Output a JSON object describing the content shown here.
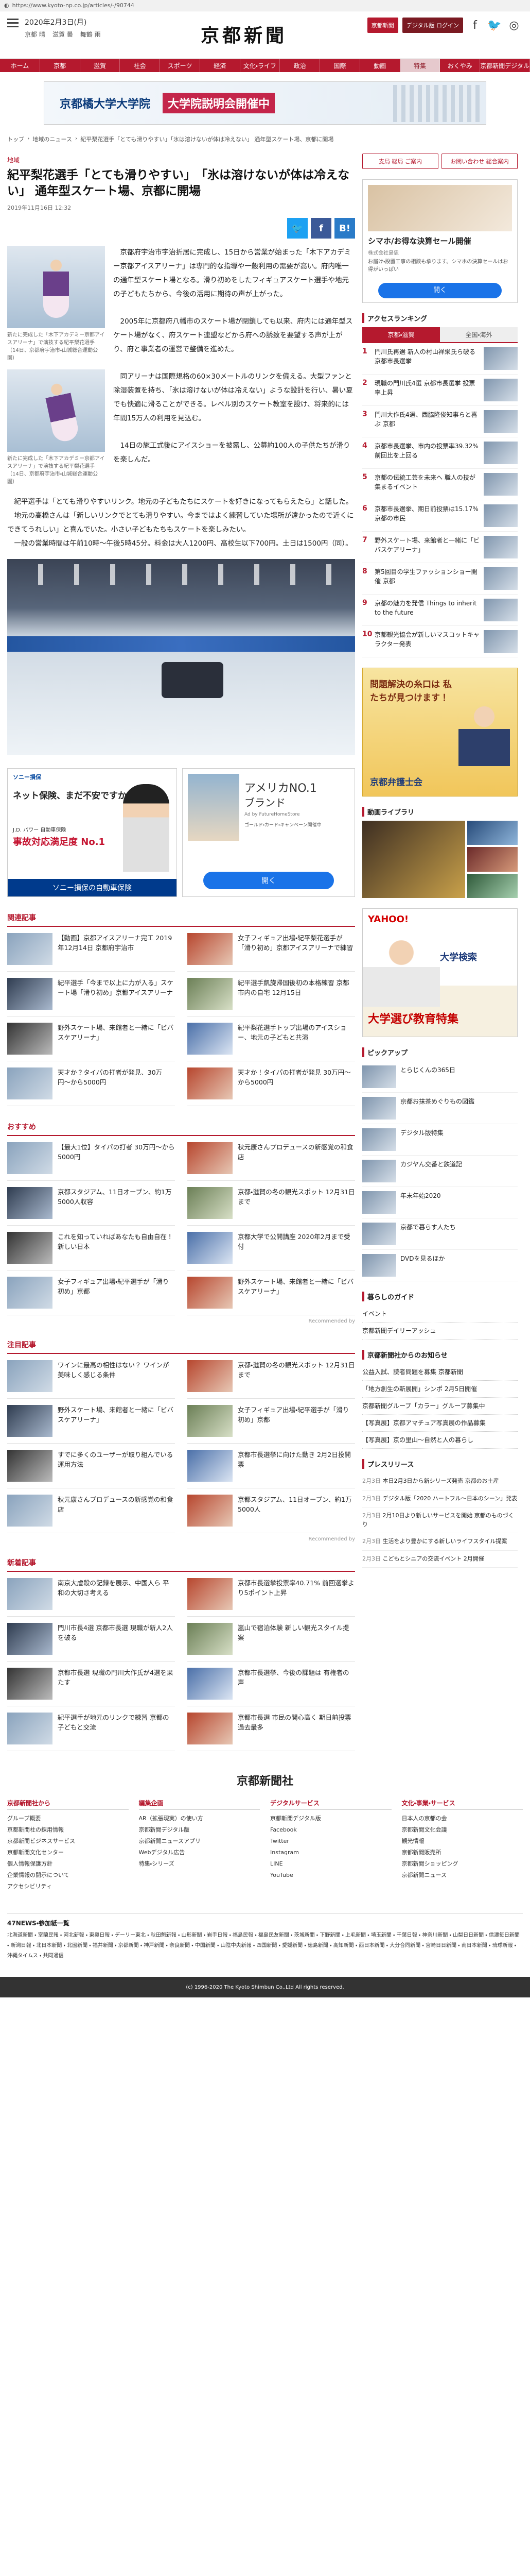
{
  "browser": {
    "url": "https://www.kyoto-np.co.jp/articles/-/90744"
  },
  "header": {
    "date": "2020年2月3日(月)",
    "weather": [
      "晴",
      "曇",
      "雨"
    ],
    "weather_labels": [
      "京都",
      "滋賀",
      "舞鶴"
    ],
    "logo": "京都新聞",
    "buttons": [
      "京都新聞",
      "デジタル版 ログイン"
    ],
    "social_icons": [
      "facebook-icon",
      "twitter-icon",
      "instagram-icon"
    ]
  },
  "nav": [
    {
      "label": "ホーム"
    },
    {
      "label": "京都"
    },
    {
      "label": "滋賀"
    },
    {
      "label": "社会"
    },
    {
      "label": "スポーツ"
    },
    {
      "label": "経済"
    },
    {
      "label": "文化・ライフ"
    },
    {
      "label": "政治"
    },
    {
      "label": "国際"
    },
    {
      "label": "動画"
    },
    {
      "label": "特集",
      "active": true
    },
    {
      "label": "おくやみ"
    },
    {
      "label": "京都新聞デジタル"
    }
  ],
  "banner_top": {
    "left": "京都橘大学大学院",
    "right": "大学院説明会開催中"
  },
  "breadcrumb": [
    "トップ",
    "地域のニュース",
    "紀平梨花選手「とても滑りやすい」「氷は溶けないが体は冷えない」 通年型スケート場、京都に開場"
  ],
  "article": {
    "category": "地域",
    "title": "紀平梨花選手「とても滑りやすい」　「氷は溶けないが体は冷えない」 通年型スケート場、京都に開場",
    "date": "2019年11月16日 12:32",
    "share": [
      "twitter",
      "facebook",
      "hatena"
    ],
    "figures": [
      {
        "caption": "新たに完成した「木下アカデミー京都アイスアリーナ」で演技する紀平梨花選手（14日、京都府宇治市・山城総合運動公園）"
      },
      {
        "caption": "新たに完成した「木下アカデミー京都アイスアリーナ」で演技する紀平梨花選手（14日、京都府宇治市・山城総合運動公園）"
      }
    ],
    "paragraphs": [
      "京都府宇治市宇治折居に完成し、15日から営業が始まった「木下アカデミー京都アイスアリーナ」は専門的な指導や一般利用の需要が高い。府内唯一の通年型スケート場となる。滑り初めをしたフィギュアスケート選手や地元の子どもたちから、今後の活用に期待の声が上がった。",
      "2005年に京都府八幡市のスケート場が閉鎖しても以来、府内には通年型スケート場がなく、府スケート連盟などから府への誘致を要望する声が上がり、府と事業者の運営で整備を進めた。",
      "同アリーナは国際規格の60×30メートルのリンクを備える。大型ファンと除湿装置を持ち、「氷は溶けないが体は冷えない」ような設計を行い、暑い夏でも快適に滑ることができる。レベル別のスケート教室を設け、将来的には年間15万人の利用を見込む。",
      "14日の施工式後にアイスショーを披露し、公募約100人の子供たちが滑りを楽しんだ。"
    ],
    "full_paragraphs": [
      "紀平選手は「とても滑りやすいリンク。地元の子どもたちにスケートを好きになってもらえたら」と話した。",
      "地元の高橋さんは「新しいリンクでとても滑りやすい。今まではよく練習していた場所が遠かったので近くにできてうれしい」と喜んでいた。小さい子どもたちもスケートを楽しみたい。",
      "一般の営業時間は午前10時〜午後5時45分。料金は大人1200円、高校生以下700円。土日は1500円（同）。"
    ]
  },
  "ads": {
    "sony": {
      "brand": "ソニー損保",
      "headline": "ネット保険、まだ不安ですか？",
      "sub": "J.D. パワー 自動車保険",
      "claim": "事故対応満足度 No.1",
      "footer": "ソニー損保の自動車保険"
    },
    "amex": {
      "title": "アメリカNO.1",
      "title2": "ブランド",
      "sponsor": "Ad by FutureHomeStore",
      "note": "ゴールド・カード・キャンペーン開催中",
      "button": "開く"
    }
  },
  "related": {
    "title": "関連記事",
    "items": [
      {
        "text": "【動画】京都アイスアリーナ完工 2019年12月14日 京都府宇治市"
      },
      {
        "text": "女子フィギュア出場・紀平梨花選手が「滑り初め」京都アイスアリーナで練習"
      },
      {
        "text": "紀平選手「今まで以上に力が入る」スケート場「滑り初め」京都アイスアリーナ"
      },
      {
        "text": "紀平選手凱旋帰国後初の本格練習 京都市内の自宅 12月15日"
      },
      {
        "text": "野外スケート場、来館者と一緒に「ビバスケアリーナ」"
      },
      {
        "text": "紀平梨花選手トップ出場のアイスショー、地元の子どもと共演"
      },
      {
        "text": "天才か？タイパの打者が発見、30万円〜から5000円"
      },
      {
        "text": "天才か！タイパの打者が発見 30万円〜から5000円"
      }
    ]
  },
  "recommend": {
    "title": "おすすめ",
    "items": [
      {
        "text": "【最大1位】タイパの打者 30万円〜から5000円"
      },
      {
        "text": "秋元康さんプロデュースの新感覚の和食店"
      },
      {
        "text": "京都スタジアム、11日オープン、約1万5000人収容"
      },
      {
        "text": "京都・滋賀の冬の観光スポット 12月31日まで"
      },
      {
        "text": "これを知っていればあなたも自由自在！新しい日本"
      },
      {
        "text": "京都大学で公開講座 2020年2月まで受付"
      },
      {
        "text": "女子フィギュア出場・紀平選手が「滑り初め」京都"
      },
      {
        "text": "野外スケート場、来館者と一緒に「ビバスケアリーナ」"
      }
    ],
    "powered": "Recommended by"
  },
  "attention": {
    "title": "注目記事",
    "items": [
      {
        "text": "ワインに最高の相性はない？ ワインが美味しく感じる条件"
      },
      {
        "text": "京都・滋賀の冬の観光スポット 12月31日まで"
      },
      {
        "text": "野外スケート場、来館者と一緒に「ビバスケアリーナ」"
      },
      {
        "text": "女子フィギュア出場・紀平選手が「滑り初め」京都"
      },
      {
        "text": "すでに多くのユーザーが取り組んでいる運用方法"
      },
      {
        "text": "京都市長選挙に向けた動き 2月2日投開票"
      },
      {
        "text": "秋元康さんプロデュースの新感覚の和食店"
      },
      {
        "text": "京都スタジアム、11日オープン、約1万5000人"
      }
    ],
    "powered": "Recommended by"
  },
  "latest": {
    "title": "新着記事",
    "items": [
      {
        "text": "南京大虐殺の記録を展示、中国人ら 平和の大切さ考える"
      },
      {
        "text": "京都市長選挙投票率40.71% 前回選挙より5ポイント上昇"
      },
      {
        "text": "門川市長4選 京都市長選 現職が新人2人を破る"
      },
      {
        "text": "嵐山で宿泊体験 新しい観光スタイル提案"
      },
      {
        "text": "京都市長選 現職の門川大作氏が4選を果たす"
      },
      {
        "text": "京都市長選挙、今後の課題は 有権者の声"
      },
      {
        "text": "紀平選手が地元のリンクで練習 京都の子どもと交流"
      },
      {
        "text": "京都市長選 市民の関心高く 期日前投票過去最多"
      }
    ]
  },
  "sidebar": {
    "ad_top": {
      "title": "シマホ/お得な決算セール開催",
      "sponsor": "株式会社島忠",
      "desc": "お届け・設置工事の相談も承ります。シマホの決算セールはお得がいっぱい",
      "button": "開く"
    },
    "office_links": [
      "支局 総局 ご案内",
      "お問い合わせ 総合案内"
    ],
    "ranking": {
      "title": "アクセスランキング",
      "tabs": [
        "京都・滋賀",
        "全国・海外"
      ],
      "items": [
        {
          "num": "1",
          "text": "門川氏再選 新人の村山祥栄氏ら破る 京都市長選挙"
        },
        {
          "num": "2",
          "text": "現職の門川氏4選 京都市長選挙 投票率上昇"
        },
        {
          "num": "3",
          "text": "門川大作氏4選、西脇隆俊知事らと喜ぶ 京都"
        },
        {
          "num": "4",
          "text": "京都市長選挙、市内の投票率39.32% 前回比を上回る"
        },
        {
          "num": "5",
          "text": "京都の伝統工芸を未来へ 職人の技が集まるイベント"
        },
        {
          "num": "6",
          "text": "京都市長選挙、期日前投票は15.17% 京都の市民"
        },
        {
          "num": "7",
          "text": "野外スケート場、来館者と一緒に「ビバスケアリーナ」"
        },
        {
          "num": "8",
          "text": "第5回目の学生ファッションショー開催 京都"
        },
        {
          "num": "9",
          "text": "京都の魅力を発信 Things to inherit to the future"
        },
        {
          "num": "10",
          "text": "京都観光協会が新しいマスコットキャラクター発表"
        }
      ]
    },
    "ad_lawyer": {
      "title": "問題解決の糸口は 私たちが見つけます！",
      "org": "京都弁護士会"
    },
    "photo_library": {
      "title": "動画ライブラリ"
    },
    "ad_yahoo": {
      "title": "大学検索",
      "sub": "大学選び教育特集"
    },
    "pickup": {
      "title": "ピックアップ",
      "items": [
        {
          "text": "とらじくんの365日"
        },
        {
          "text": "京都お抹茶めぐりもの図鑑"
        },
        {
          "text": "デジタル版特集"
        },
        {
          "text": "カジヤん交番と鉄道記"
        },
        {
          "text": "年末年始2020"
        },
        {
          "text": "京都で暮らす人たち"
        },
        {
          "text": "DVDを見るほか"
        }
      ]
    },
    "guide": {
      "title": "暮らしのガイド",
      "items": [
        "イベント",
        "京都新聞デイリーアッシュ"
      ]
    },
    "company_news": {
      "title": "京都新聞社からのお知らせ",
      "items": [
        "公益入試、読者問題を募集 京都新聞",
        "「地方創生の新展開」シンポ 2月5日開催",
        "京都新聞グループ「カラー」グループ募集中",
        "【写真展】京都アマチュア写真展の作品募集",
        "【写真展】京の里山〜自然と人の暮らし"
      ]
    },
    "press": {
      "title": "プレスリリース",
      "items": [
        {
          "date": "2月3日",
          "text": "本日2月3日から新シリーズ発売 京都のお土産"
        },
        {
          "date": "2月3日",
          "text": "デジタル版「2020 ハートフル〜日本のシーン」発表"
        },
        {
          "date": "2月3日",
          "text": "2月10日より新しいサービスを開始 京都のものづくり"
        },
        {
          "date": "2月3日",
          "text": "生活をより豊かにする新しいライフスタイル提案"
        },
        {
          "date": "2月3日",
          "text": "こどもとシニアの交流イベント 2月開催"
        }
      ]
    }
  },
  "footer": {
    "logo": "京都新聞社",
    "columns": [
      {
        "title": "京都新聞社から",
        "items": [
          "グループ概要",
          "京都新聞社の採用情報",
          "京都新聞ビジネスサービス",
          "京都新聞文化センター",
          "個人情報保護方針",
          "企業情報の開示について",
          "アクセシビリティ"
        ]
      },
      {
        "title": "編集企画",
        "items": [
          "AR（拡張現実）の使い方",
          "京都新聞デジタル版",
          "京都新聞ニュースアプリ",
          "Webデジタル広告",
          "特集・シリーズ"
        ]
      },
      {
        "title": "デジタルサービス",
        "items": [
          "京都新聞デジタル版",
          "Facebook",
          "Twitter",
          "Instagram",
          "LINE",
          "YouTube"
        ]
      },
      {
        "title": "文化・事業・サービス",
        "items": [
          "日本人の京都の会",
          "京都新聞文化会議",
          "観光情報",
          "京都新聞販売所",
          "京都新聞ショッピング",
          "京都新聞ニュース"
        ]
      }
    ]
  },
  "kyodo": {
    "title": "47NEWS・参加紙一覧",
    "links": "北海道新聞 ・ 室蘭民報 ・ 河北新報 ・ 東奥日報 ・ デーリー東北 ・ 秋田魁新報 ・ 山形新聞 ・ 岩手日報 ・ 福島民報 ・ 福島民友新聞 ・ 茨城新聞 ・ 下野新聞 ・ 上毛新聞 ・ 埼玉新聞 ・ 千葉日報 ・ 神奈川新聞 ・ 山梨日日新聞 ・ 信濃毎日新聞 ・ 新潟日報 ・ 北日本新聞 ・ 北國新聞 ・ 福井新聞 ・ 京都新聞 ・ 神戸新聞 ・ 奈良新聞 ・ 中国新聞 ・ 山陰中央新報 ・ 四国新聞 ・ 愛媛新聞 ・ 徳島新聞 ・ 高知新聞 ・ 西日本新聞 ・ 大分合同新聞 ・ 宮崎日日新聞 ・ 南日本新聞 ・ 琉球新報 ・ 沖縄タイムス ・ 共同通信"
  },
  "copyright": "(c) 1996-2020 The Kyoto Shimbun Co.,Ltd All rights reserved."
}
